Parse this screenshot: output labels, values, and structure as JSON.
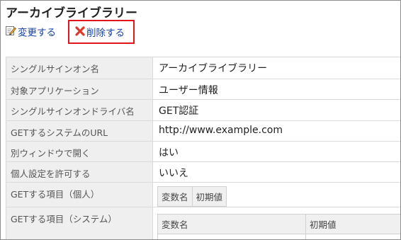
{
  "page": {
    "title": "アーカイブライブラリー"
  },
  "toolbar": {
    "edit_label": "変更する",
    "edit_icon": "edit-icon",
    "delete_label": "削除する",
    "delete_icon": "delete-x-icon",
    "delete_highlight_color": "#e3151a",
    "link_color": "#1a44a3"
  },
  "details": {
    "rows": [
      {
        "label": "シングルサインオン名",
        "value": "アーカイブライブラリー"
      },
      {
        "label": "対象アプリケーション",
        "value": "ユーザー情報"
      },
      {
        "label": "シングルサインオンドライバ名",
        "value": "GET認証"
      },
      {
        "label": "GETするシステムのURL",
        "value": "http://www.example.com"
      },
      {
        "label": "別ウィンドウで開く",
        "value": "はい"
      },
      {
        "label": "個人設定を許可する",
        "value": "いいえ"
      },
      {
        "label": "GETする項目（個人）",
        "columns": [
          "変数名",
          "初期値"
        ]
      },
      {
        "label": "GETする項目（システム）",
        "columns": [
          "変数名",
          "初期値"
        ]
      }
    ]
  }
}
